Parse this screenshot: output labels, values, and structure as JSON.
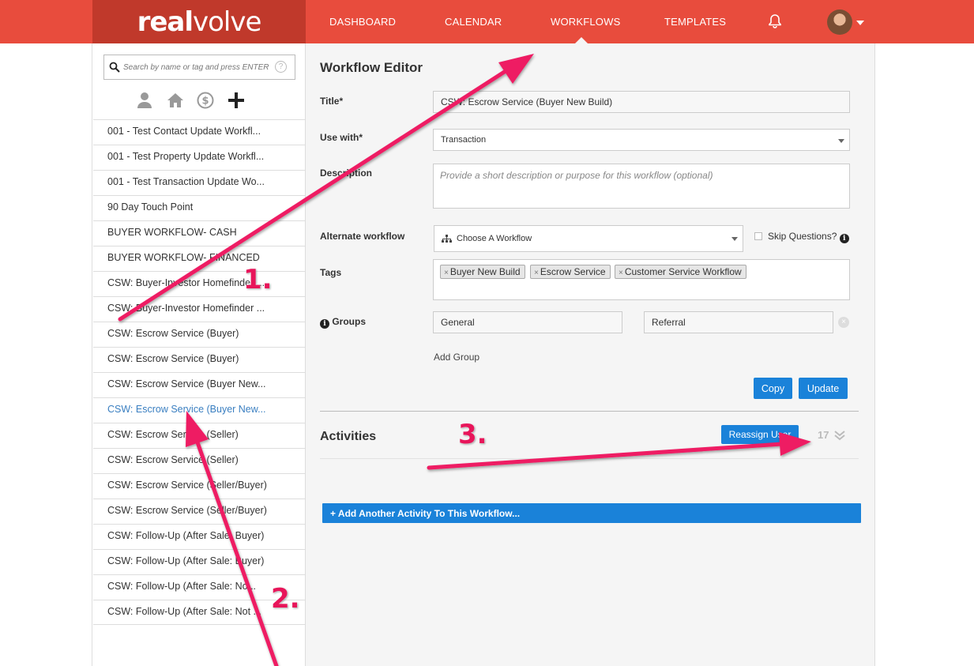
{
  "brand": {
    "logo_bold": "real",
    "logo_light": "volve"
  },
  "nav": {
    "items": [
      "DASHBOARD",
      "CALENDAR",
      "WORKFLOWS",
      "TEMPLATES"
    ],
    "active": "WORKFLOWS",
    "icons": [
      "bell-icon",
      "avatar",
      "caret-down-icon"
    ]
  },
  "sidebar": {
    "search_placeholder": "Search by name or tag and press ENTER",
    "help_glyph": "?",
    "filter_icons": [
      "person-icon",
      "home-icon",
      "dollar-icon",
      "plus-icon"
    ],
    "workflows": [
      "001 - Test Contact Update Workfl...",
      "001 - Test Property Update Workfl...",
      "001 - Test Transaction Update Wo...",
      "90 Day Touch Point",
      "BUYER WORKFLOW- CASH",
      "BUYER WORKFLOW- FINANCED",
      "CSW: Buyer-Investor Homefinder ...",
      "CSW: Buyer-Investor Homefinder ...",
      "CSW: Escrow Service (Buyer)",
      "CSW: Escrow Service (Buyer)",
      "CSW: Escrow Service (Buyer New...",
      "CSW: Escrow Service (Buyer New...",
      "CSW: Escrow Service (Seller)",
      "CSW: Escrow Service (Seller)",
      "CSW: Escrow Service (Seller/Buyer)",
      "CSW: Escrow Service (Seller/Buyer)",
      "CSW: Follow-Up (After Sale: Buyer)",
      "CSW: Follow-Up (After Sale: Buyer)",
      "CSW: Follow-Up (After Sale: No...",
      "CSW: Follow-Up (After Sale: Not ..."
    ],
    "active_index": 11,
    "active_color": "#3a7fc1"
  },
  "editor": {
    "heading": "Workflow Editor",
    "title_label": "Title",
    "title_value": "CSW: Escrow Service (Buyer New Build)",
    "use_with_label": "Use with",
    "use_with_value": "Transaction",
    "required_mark": "*",
    "description_label": "Description",
    "description_placeholder": "Provide a short description or purpose for this workflow (optional)",
    "alternate_label": "Alternate workflow",
    "alternate_value": "Choose A Workflow",
    "skip_label": "Skip Questions?",
    "tags_label": "Tags",
    "tag_remove_glyph": "×",
    "tags": [
      "Buyer New Build",
      "Escrow Service",
      "Customer Service Workflow"
    ],
    "groups_label": "Groups",
    "info_glyph": "i",
    "groups": [
      "General",
      "Referral"
    ],
    "group_remove_glyph": "×",
    "add_group": "Add Group",
    "copy_button": "Copy",
    "update_button": "Update"
  },
  "activities": {
    "heading": "Activities",
    "reassign_button": "Reassign User",
    "count": "17",
    "add_activity": "+ Add Another Activity To This Workflow..."
  },
  "annotations": {
    "labels": [
      "1.",
      "2.",
      "3."
    ],
    "color": "#e8155a"
  },
  "colors": {
    "nav_bg": "#e84c3d",
    "logo_bg": "#c0392b",
    "primary_button": "#1a82d9"
  }
}
